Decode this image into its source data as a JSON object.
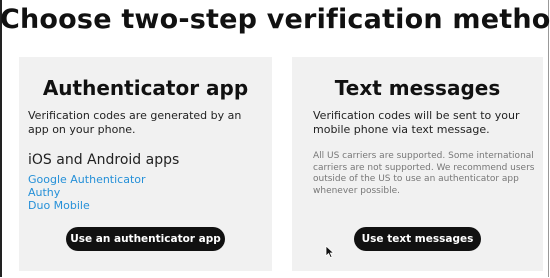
{
  "heading": "Choose two-step verification method",
  "authenticator": {
    "title": "Authenticator app",
    "description": "Verification codes are generated by an app on your phone.",
    "subheading": "iOS and Android apps",
    "apps": [
      "Google Authenticator",
      "Authy",
      "Duo Mobile"
    ],
    "button_label": "Use an authenticator app"
  },
  "text_messages": {
    "title": "Text messages",
    "description": "Verification codes will be sent to your mobile phone via text message.",
    "note": "All US carriers are supported. Some international carriers are not supported. We recommend users outside of the US to use an authenticator app whenever possible.",
    "button_label": "Use text messages"
  },
  "colors": {
    "card_background": "#f1f1f1",
    "link": "#2590d8",
    "button": "#111111"
  },
  "icons": {
    "cursor": "mouse-pointer-icon"
  }
}
